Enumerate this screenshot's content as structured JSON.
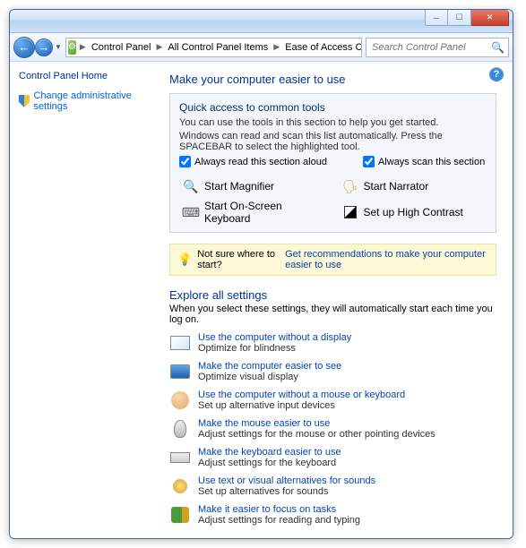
{
  "titlebar": {
    "minimize": "─",
    "maximize": "☐",
    "close": "✕"
  },
  "nav": {
    "back": "←",
    "forward": "→"
  },
  "breadcrumb": {
    "items": [
      "Control Panel",
      "All Control Panel Items",
      "Ease of Access Center"
    ]
  },
  "search": {
    "placeholder": "Search Control Panel"
  },
  "sidebar": {
    "home": "Control Panel Home",
    "admin_link": "Change administrative settings"
  },
  "help": "?",
  "main_title": "Make your computer easier to use",
  "quickbox": {
    "title": "Quick access to common tools",
    "line1": "You can use the tools in this section to help you get started.",
    "line2": "Windows can read and scan this list automatically.  Press the SPACEBAR to select the highlighted tool.",
    "chk1": "Always read this section aloud",
    "chk2": "Always scan this section"
  },
  "tools": {
    "magnifier": "Start Magnifier",
    "osk": "Start On-Screen Keyboard",
    "narrator": "Start Narrator",
    "contrast": "Set up High Contrast"
  },
  "hint": {
    "lead": "Not sure where to start?",
    "link": "Get recommendations to make your computer easier to use"
  },
  "explore": {
    "title": "Explore all settings",
    "sub": "When you select these settings, they will automatically start each time you log on."
  },
  "settings": [
    {
      "title": "Use the computer without a display",
      "desc": "Optimize for blindness",
      "icon": "ico-display"
    },
    {
      "title": "Make the computer easier to see",
      "desc": "Optimize visual display",
      "icon": "ico-see"
    },
    {
      "title": "Use the computer without a mouse or keyboard",
      "desc": "Set up alternative input devices",
      "icon": "ico-nohands"
    },
    {
      "title": "Make the mouse easier to use",
      "desc": "Adjust settings for the mouse or other pointing devices",
      "icon": "ico-mouse"
    },
    {
      "title": "Make the keyboard easier to use",
      "desc": "Adjust settings for the keyboard",
      "icon": "ico-kb"
    },
    {
      "title": "Use text or visual alternatives for sounds",
      "desc": "Set up alternatives for sounds",
      "icon": "ico-sound"
    },
    {
      "title": "Make it easier to focus on tasks",
      "desc": "Adjust settings for reading and typing",
      "icon": "ico-focus"
    }
  ]
}
